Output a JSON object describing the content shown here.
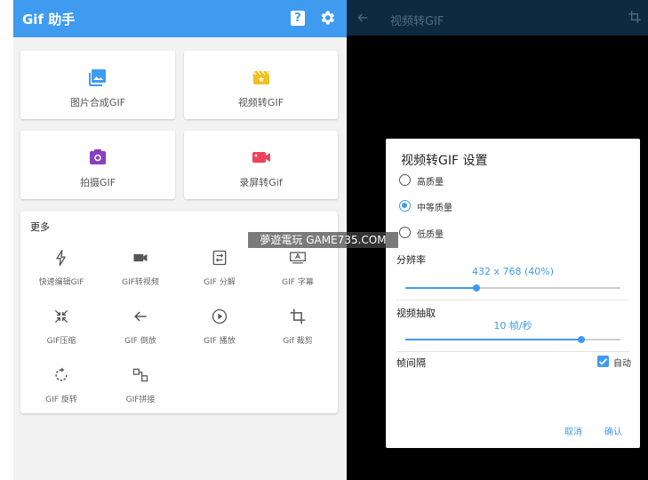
{
  "left": {
    "appbar": {
      "title": "Gif 助手",
      "help_glyph": "?",
      "help_icon": "help-icon",
      "settings_icon": "gear-icon",
      "color": "#3f9bf0"
    },
    "cards": [
      {
        "label": "图片合成GIF",
        "icon": "image-icon",
        "color": "#3f9bf0"
      },
      {
        "label": "视频转GIF",
        "icon": "movie-icon",
        "color": "#f4c01e"
      },
      {
        "label": "拍摄GIF",
        "icon": "camera-icon",
        "color": "#8a3fc0"
      },
      {
        "label": "录屏转Gif",
        "icon": "videocam-icon",
        "color": "#f0415b"
      }
    ],
    "more": {
      "title": "更多",
      "tools": [
        {
          "label": "快速编辑GIF",
          "icon": "flash-icon"
        },
        {
          "label": "GIF转视频",
          "icon": "video-camera-icon"
        },
        {
          "label": "GIF 分解",
          "icon": "split-icon"
        },
        {
          "label": "GIF 字幕",
          "icon": "subtitle-icon"
        },
        {
          "label": "GIF压缩",
          "icon": "compress-icon"
        },
        {
          "label": "GIF 倒放",
          "icon": "arrow-back-icon"
        },
        {
          "label": "GIF 播放",
          "icon": "play-icon"
        },
        {
          "label": "Gif 裁剪",
          "icon": "crop-icon"
        },
        {
          "label": "GIF 旋转",
          "icon": "rotate-icon"
        },
        {
          "label": "GIF拼接",
          "icon": "join-icon"
        }
      ]
    }
  },
  "right": {
    "toolbar": {
      "title": "视频转GIF",
      "back_icon": "arrow-back-icon",
      "crop_icon": "crop-icon"
    },
    "dialog": {
      "title": "视频转GIF 设置",
      "quality_options": [
        {
          "label": "高质量",
          "selected": false
        },
        {
          "label": "中等质量",
          "selected": true
        },
        {
          "label": "低质量",
          "selected": false
        }
      ],
      "resolution": {
        "label": "分辨率",
        "value": "432 x 768  (40%)",
        "fraction": 0.33
      },
      "frame_rate": {
        "label": "视频抽取",
        "value": "10 帧/秒",
        "fraction": 0.82
      },
      "interval": {
        "label": "帧间隔",
        "checkbox_label": "自动",
        "checked": true
      },
      "cancel_label": "取消",
      "confirm_label": "确认",
      "accent": "#3f9bf0"
    }
  },
  "watermark": "夢遊電玩 GAME735.COM"
}
